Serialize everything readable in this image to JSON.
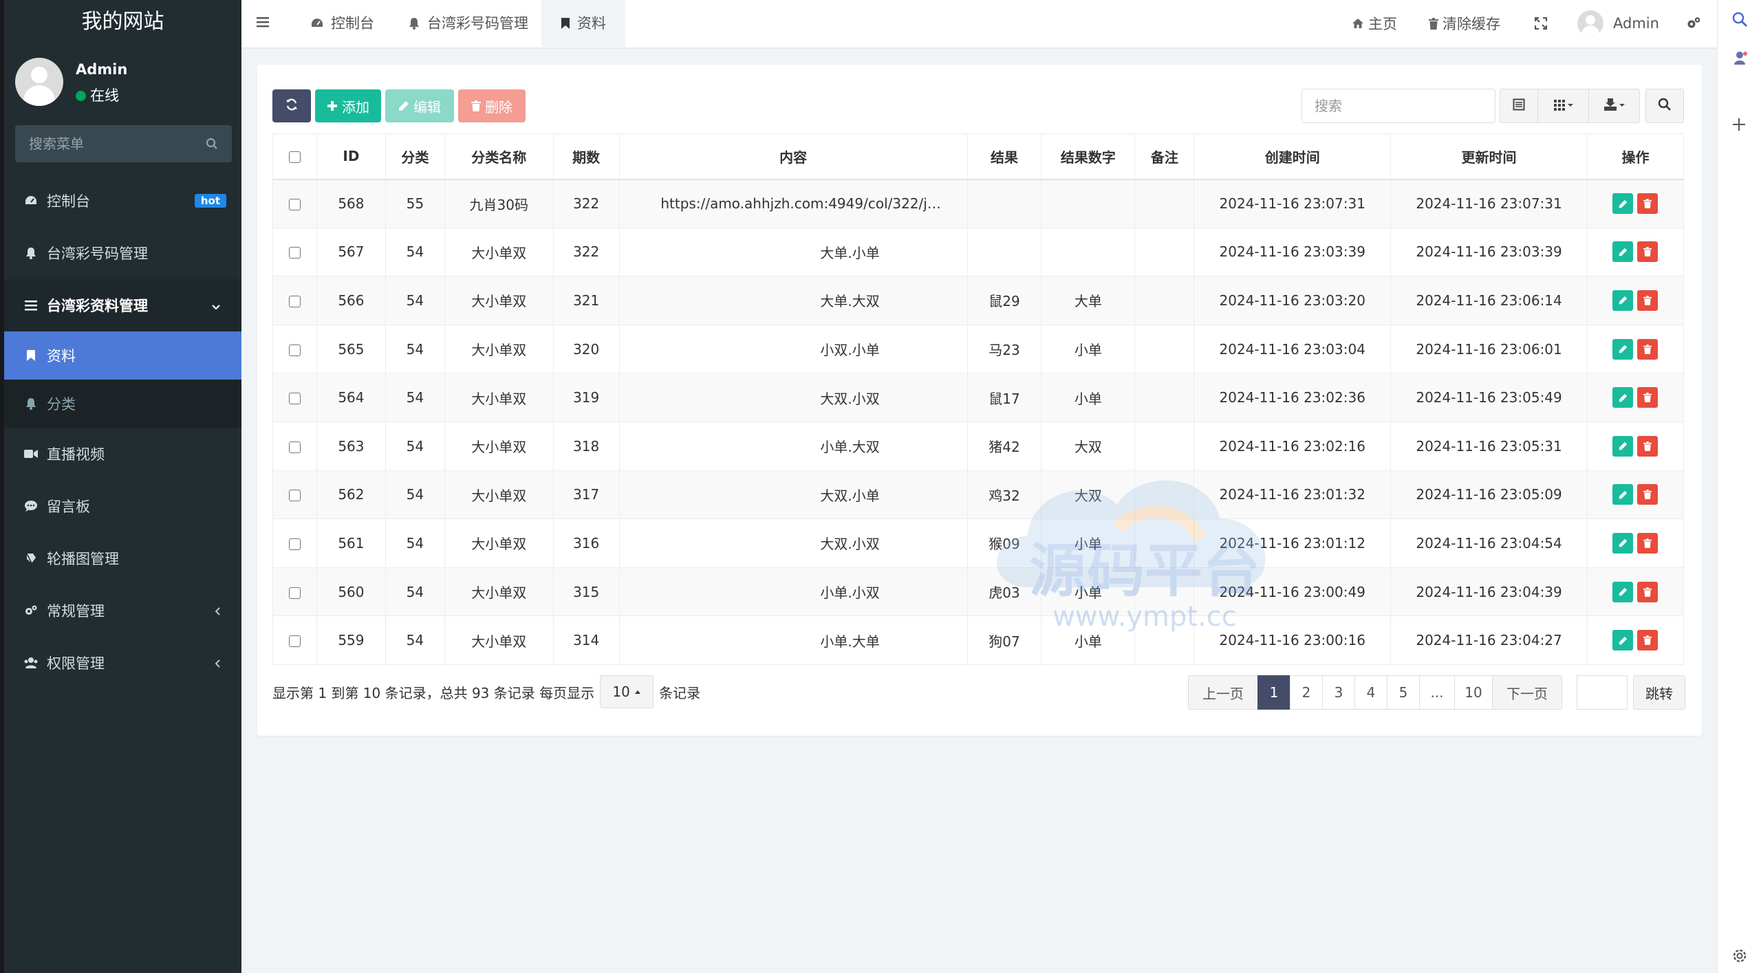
{
  "sidebar": {
    "logo": "我的网站",
    "user": {
      "name": "Admin",
      "status": "在线"
    },
    "search_placeholder": "搜索菜单",
    "items": [
      {
        "label": "控制台",
        "icon": "dashboard-icon",
        "badge": "hot"
      },
      {
        "label": "台湾彩号码管理",
        "icon": "bell-icon"
      },
      {
        "label": "台湾彩资料管理",
        "icon": "list-icon",
        "expanded": true,
        "children": [
          {
            "label": "资料",
            "icon": "bookmark-icon",
            "active": true
          },
          {
            "label": "分类",
            "icon": "bell-icon"
          }
        ]
      },
      {
        "label": "直播视频",
        "icon": "video-icon"
      },
      {
        "label": "留言板",
        "icon": "comment-icon"
      },
      {
        "label": "轮播图管理",
        "icon": "image-icon"
      },
      {
        "label": "常规管理",
        "icon": "cogs-icon",
        "collapsible": true
      },
      {
        "label": "权限管理",
        "icon": "users-icon",
        "collapsible": true
      }
    ]
  },
  "topnav": {
    "tabs": [
      {
        "label": "控制台",
        "icon": "dashboard-icon"
      },
      {
        "label": "台湾彩号码管理",
        "icon": "bell-icon"
      },
      {
        "label": "资料",
        "icon": "bookmark-icon",
        "active": true
      }
    ],
    "home_label": "主页",
    "clear_cache_label": "清除缓存",
    "user_name": "Admin"
  },
  "toolbar": {
    "add_label": "添加",
    "edit_label": "编辑",
    "delete_label": "删除",
    "search_placeholder": "搜索"
  },
  "table": {
    "columns": [
      "",
      "ID",
      "分类",
      "分类名称",
      "期数",
      "内容",
      "结果",
      "结果数字",
      "备注",
      "创建时间",
      "更新时间",
      "操作"
    ],
    "rows": [
      {
        "id": "568",
        "cat": "55",
        "cat_name": "九肖30码",
        "issue": "322",
        "content": "https://amo.ahhjzh.com:4949/col/322/j…",
        "result": "",
        "result_num": "",
        "note": "",
        "created": "2024-11-16 23:07:31",
        "updated": "2024-11-16 23:07:31"
      },
      {
        "id": "567",
        "cat": "54",
        "cat_name": "大小单双",
        "issue": "322",
        "content": "大单.小单",
        "result": "",
        "result_num": "",
        "note": "",
        "created": "2024-11-16 23:03:39",
        "updated": "2024-11-16 23:03:39"
      },
      {
        "id": "566",
        "cat": "54",
        "cat_name": "大小单双",
        "issue": "321",
        "content": "大单.大双",
        "result": "鼠29",
        "result_num": "大单",
        "note": "",
        "created": "2024-11-16 23:03:20",
        "updated": "2024-11-16 23:06:14"
      },
      {
        "id": "565",
        "cat": "54",
        "cat_name": "大小单双",
        "issue": "320",
        "content": "小双.小单",
        "result": "马23",
        "result_num": "小单",
        "note": "",
        "created": "2024-11-16 23:03:04",
        "updated": "2024-11-16 23:06:01"
      },
      {
        "id": "564",
        "cat": "54",
        "cat_name": "大小单双",
        "issue": "319",
        "content": "大双.小双",
        "result": "鼠17",
        "result_num": "小单",
        "note": "",
        "created": "2024-11-16 23:02:36",
        "updated": "2024-11-16 23:05:49"
      },
      {
        "id": "563",
        "cat": "54",
        "cat_name": "大小单双",
        "issue": "318",
        "content": "小单.大双",
        "result": "猪42",
        "result_num": "大双",
        "note": "",
        "created": "2024-11-16 23:02:16",
        "updated": "2024-11-16 23:05:31"
      },
      {
        "id": "562",
        "cat": "54",
        "cat_name": "大小单双",
        "issue": "317",
        "content": "大双.小单",
        "result": "鸡32",
        "result_num": "大双",
        "note": "",
        "created": "2024-11-16 23:01:32",
        "updated": "2024-11-16 23:05:09"
      },
      {
        "id": "561",
        "cat": "54",
        "cat_name": "大小单双",
        "issue": "316",
        "content": "大双.小双",
        "result": "猴09",
        "result_num": "小单",
        "note": "",
        "created": "2024-11-16 23:01:12",
        "updated": "2024-11-16 23:04:54"
      },
      {
        "id": "560",
        "cat": "54",
        "cat_name": "大小单双",
        "issue": "315",
        "content": "小单.小双",
        "result": "虎03",
        "result_num": "小单",
        "note": "",
        "created": "2024-11-16 23:00:49",
        "updated": "2024-11-16 23:04:39"
      },
      {
        "id": "559",
        "cat": "54",
        "cat_name": "大小单双",
        "issue": "314",
        "content": "小单.大单",
        "result": "狗07",
        "result_num": "小单",
        "note": "",
        "created": "2024-11-16 23:00:16",
        "updated": "2024-11-16 23:04:27"
      }
    ]
  },
  "pagination": {
    "info": "显示第 1 到第 10 条记录，总共 93 条记录 每页显示",
    "page_size": "10",
    "suffix": "条记录",
    "prev": "上一页",
    "pages": [
      "1",
      "2",
      "3",
      "4",
      "5",
      "...",
      "10"
    ],
    "current": "1",
    "next": "下一页",
    "jump_label": "跳转"
  },
  "watermark": {
    "title": "源码平台",
    "url": "www.ympt.cc"
  },
  "colors": {
    "sidebar_bg": "#222d32",
    "active_menu": "#4d7ad8",
    "primary_dark": "#444c69",
    "success": "#18bc9c",
    "danger": "#e74c3c",
    "link": "#3b8ede"
  }
}
